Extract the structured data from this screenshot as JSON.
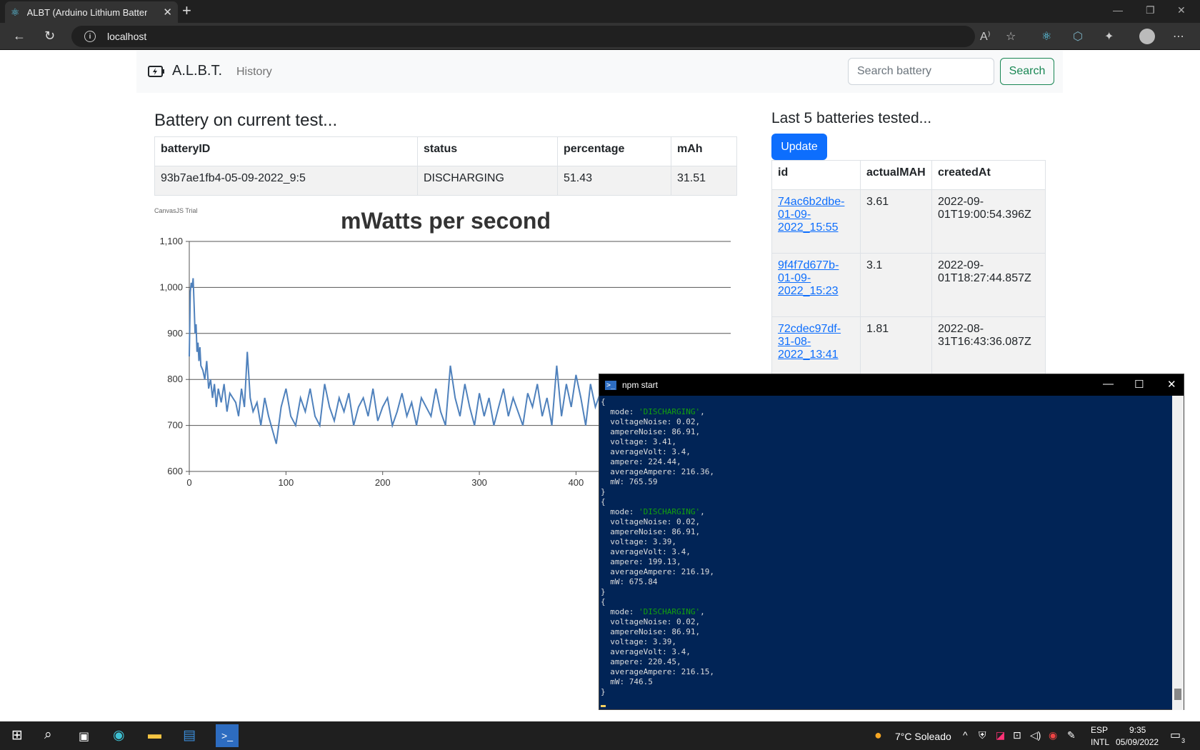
{
  "browser": {
    "tab_title": "ALBT (Arduino Lithium Battery Te",
    "url": "localhost"
  },
  "navbar": {
    "brand": "A.L.B.T.",
    "history_link": "History",
    "search_placeholder": "Search battery",
    "search_button": "Search"
  },
  "current_test": {
    "heading": "Battery on current test...",
    "columns": [
      "batteryID",
      "status",
      "percentage",
      "mAh"
    ],
    "row": [
      "93b7ae1fb4-05-09-2022_9:5",
      "DISCHARGING",
      "51.43",
      "31.51"
    ]
  },
  "chart_watermark": "CanvasJS Trial",
  "chart_data": {
    "type": "line",
    "title": "mWatts per second",
    "xlabel": "",
    "ylabel": "",
    "xlim": [
      0,
      560
    ],
    "ylim": [
      600,
      1100
    ],
    "yticks": [
      "1,100",
      "1,000",
      "900",
      "800",
      "700",
      "600"
    ],
    "xticks": [
      "0",
      "100",
      "200",
      "300",
      "400"
    ],
    "grid": true,
    "x": [
      0,
      1,
      2,
      3,
      4,
      5,
      6,
      7,
      8,
      9,
      10,
      11,
      12,
      14,
      16,
      18,
      20,
      22,
      24,
      26,
      28,
      30,
      33,
      36,
      39,
      42,
      45,
      48,
      51,
      54,
      57,
      60,
      63,
      66,
      70,
      74,
      78,
      82,
      86,
      90,
      95,
      100,
      105,
      110,
      115,
      120,
      125,
      130,
      135,
      140,
      145,
      150,
      155,
      160,
      165,
      170,
      175,
      180,
      185,
      190,
      195,
      200,
      205,
      210,
      215,
      220,
      225,
      230,
      235,
      240,
      245,
      250,
      255,
      260,
      265,
      270,
      275,
      280,
      285,
      290,
      295,
      300,
      305,
      310,
      315,
      320,
      325,
      330,
      335,
      340,
      345,
      350,
      355,
      360,
      365,
      370,
      375,
      380,
      385,
      390,
      395,
      400,
      405,
      410,
      415,
      420,
      425,
      430
    ],
    "y": [
      850,
      990,
      1010,
      1000,
      1020,
      960,
      900,
      920,
      860,
      880,
      840,
      870,
      830,
      820,
      800,
      840,
      780,
      800,
      760,
      790,
      740,
      780,
      750,
      790,
      730,
      770,
      760,
      750,
      720,
      780,
      740,
      860,
      760,
      730,
      750,
      700,
      760,
      720,
      690,
      660,
      740,
      780,
      720,
      700,
      760,
      730,
      780,
      720,
      700,
      790,
      740,
      710,
      760,
      730,
      770,
      700,
      740,
      760,
      720,
      780,
      710,
      740,
      760,
      700,
      730,
      770,
      720,
      750,
      700,
      760,
      740,
      720,
      780,
      730,
      700,
      830,
      760,
      720,
      790,
      740,
      700,
      770,
      720,
      760,
      700,
      740,
      780,
      720,
      760,
      730,
      700,
      770,
      740,
      790,
      720,
      760,
      700,
      830,
      720,
      790,
      740,
      810,
      760,
      700,
      790,
      740,
      770,
      720
    ]
  },
  "last_tested": {
    "heading": "Last 5 batteries tested...",
    "update_button": "Update",
    "columns": [
      "id",
      "actualMAH",
      "createdAt"
    ],
    "rows": [
      {
        "id": [
          "74ac6b2dbe-",
          "01-09-",
          "2022_15:55"
        ],
        "mah": "3.61",
        "created": [
          "2022-09-",
          "01T19:00:54.396Z"
        ]
      },
      {
        "id": [
          "9f4f7d677b-",
          "01-09-",
          "2022_15:23"
        ],
        "mah": "3.1",
        "created": [
          "2022-09-",
          "01T18:27:44.857Z"
        ]
      },
      {
        "id": [
          "72cdec97df-",
          "31-08-",
          "2022_13:41"
        ],
        "mah": "1.81",
        "created": [
          "2022-08-",
          "31T16:43:36.087Z"
        ]
      }
    ]
  },
  "terminal": {
    "title": "npm start",
    "entries": [
      {
        "mode": "'DISCHARGING'",
        "voltageNoise": "0.02",
        "ampereNoise": "86.91",
        "voltage": "3.41",
        "averageVolt": "3.4",
        "ampere": "224.44",
        "averageAmpere": "216.36",
        "mW": "765.59"
      },
      {
        "mode": "'DISCHARGING'",
        "voltageNoise": "0.02",
        "ampereNoise": "86.91",
        "voltage": "3.39",
        "averageVolt": "3.4",
        "ampere": "199.13",
        "averageAmpere": "216.19",
        "mW": "675.84"
      },
      {
        "mode": "'DISCHARGING'",
        "voltageNoise": "0.02",
        "ampereNoise": "86.91",
        "voltage": "3.39",
        "averageVolt": "3.4",
        "ampere": "220.45",
        "averageAmpere": "216.15",
        "mW": "746.5"
      }
    ]
  },
  "taskbar": {
    "weather": "7°C Soleado",
    "lang_top": "ESP",
    "lang_bottom": "INTL",
    "time": "9:35",
    "date": "05/09/2022",
    "notifications": "3"
  },
  "colors": {
    "accent_blue": "#0d6efd",
    "search_green": "#198754",
    "terminal_bg": "#012456",
    "chart_line": "#4f81bc"
  }
}
